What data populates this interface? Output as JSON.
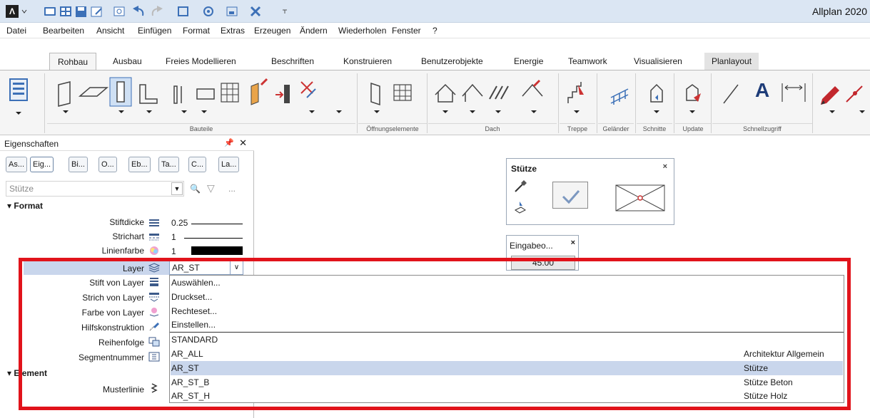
{
  "window": {
    "app_title": "Allplan 2020",
    "app_logo": "Λ",
    "quick_access_icons": [
      "open-folder-icon",
      "grid-icon",
      "save-icon",
      "edit-icon",
      "zoom-icon",
      "undo-icon",
      "redo-icon",
      "copy-icon",
      "settings-icon",
      "layer-icon",
      "tools-icon",
      "customize-icon"
    ]
  },
  "menu": {
    "items": [
      "Datei",
      "Bearbeiten",
      "Ansicht",
      "Einfügen",
      "Format",
      "Extras",
      "Erzeugen",
      "Ändern",
      "Wiederholen",
      "Fenster",
      "?"
    ]
  },
  "ribbon": {
    "tabs": [
      "Rohbau",
      "Ausbau",
      "Freies Modellieren",
      "Beschriften",
      "Konstruieren",
      "Benutzerobjekte",
      "Energie",
      "Teamwork",
      "Visualisieren",
      "Planlayout"
    ],
    "active_tab": "Rohbau",
    "groups": [
      "Bauteile",
      "Öffnungselemente",
      "Dach",
      "Treppe",
      "Geländer",
      "Schnitte",
      "Update",
      "Schnellzugriff"
    ],
    "text_tool": "A"
  },
  "palette": {
    "title": "Eigenschaften",
    "pin": "q",
    "close": "✕",
    "tabs": [
      "As...",
      "Eig...",
      "Bi...",
      "O...",
      "Eb...",
      "Ta...",
      "C...",
      "La..."
    ],
    "selector_placeholder": "Stütze",
    "selector_extra": "...",
    "section_format": "Format",
    "section_element": "Element",
    "rows": {
      "stiftdicke": {
        "label": "Stiftdicke",
        "value": "0.25"
      },
      "strichart": {
        "label": "Strichart",
        "value": "1"
      },
      "linienfarbe": {
        "label": "Linienfarbe",
        "value": "1"
      },
      "layer": {
        "label": "Layer",
        "value": "AR_ST"
      },
      "stift_von_layer": {
        "label": "Stift von Layer"
      },
      "strich_von_layer": {
        "label": "Strich von Layer"
      },
      "farbe_von_layer": {
        "label": "Farbe von Layer"
      },
      "hilfskonstruktion": {
        "label": "Hilfskonstruktion"
      },
      "reihenfolge": {
        "label": "Reihenfolge"
      },
      "segmentnummer": {
        "label": "Segmentnummer"
      },
      "musterlinie": {
        "label": "Musterlinie"
      }
    }
  },
  "dialog_stuetze": {
    "title": "Stütze",
    "close": "×"
  },
  "input_dialog": {
    "title": "Eingabeo...",
    "close": "×",
    "value": "45.00"
  },
  "layer_dropdown": {
    "actions": [
      "Auswählen...",
      "Druckset...",
      "Rechteset...",
      "Einstellen..."
    ],
    "layers": [
      {
        "name": "STANDARD",
        "desc": ""
      },
      {
        "name": "AR_ALL",
        "desc": "Architektur Allgemein"
      },
      {
        "name": "AR_ST",
        "desc": "Stütze",
        "selected": true
      },
      {
        "name": "AR_ST_B",
        "desc": "Stütze Beton"
      },
      {
        "name": "AR_ST_H",
        "desc": "Stütze Holz"
      }
    ]
  },
  "colors": {
    "highlight": "#e1131b",
    "selection": "#c9d6ec",
    "titlebar": "#dbe6f3"
  }
}
